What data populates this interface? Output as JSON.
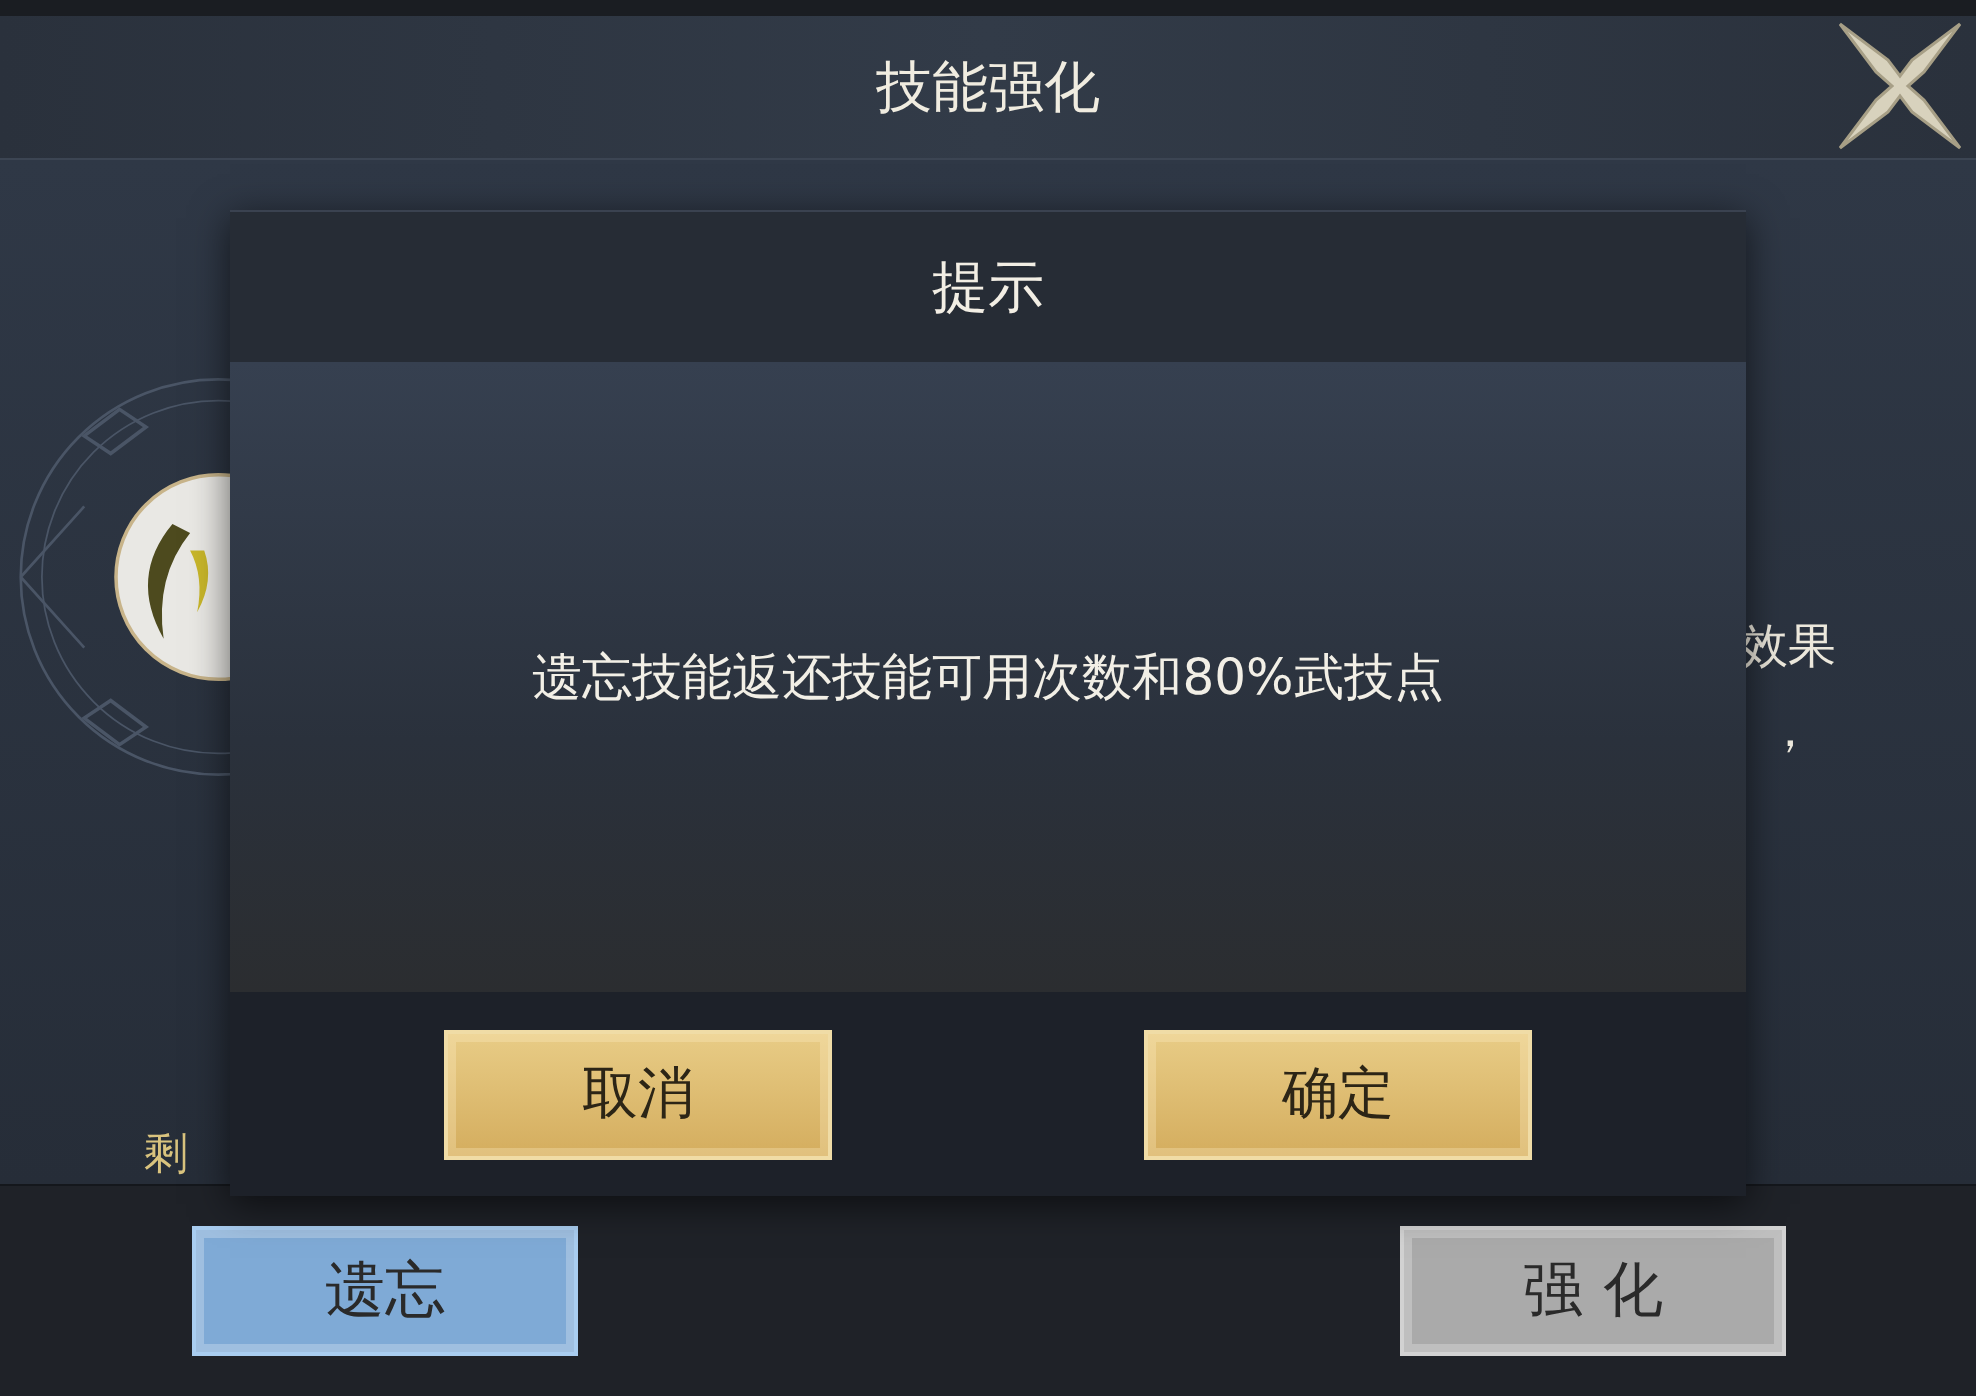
{
  "window": {
    "title": "技能强化"
  },
  "background": {
    "remaining_label": "剩",
    "description_lines": [
      "效果",
      "，"
    ]
  },
  "dialog": {
    "title": "提示",
    "message": "遗忘技能返还技能可用次数和80%武技点",
    "buttons": [
      {
        "label": "取消"
      },
      {
        "label": "确定"
      }
    ]
  },
  "actions": [
    {
      "label": "遗忘",
      "kind": "primary"
    },
    {
      "label": "强 化",
      "kind": "secondary"
    }
  ]
}
